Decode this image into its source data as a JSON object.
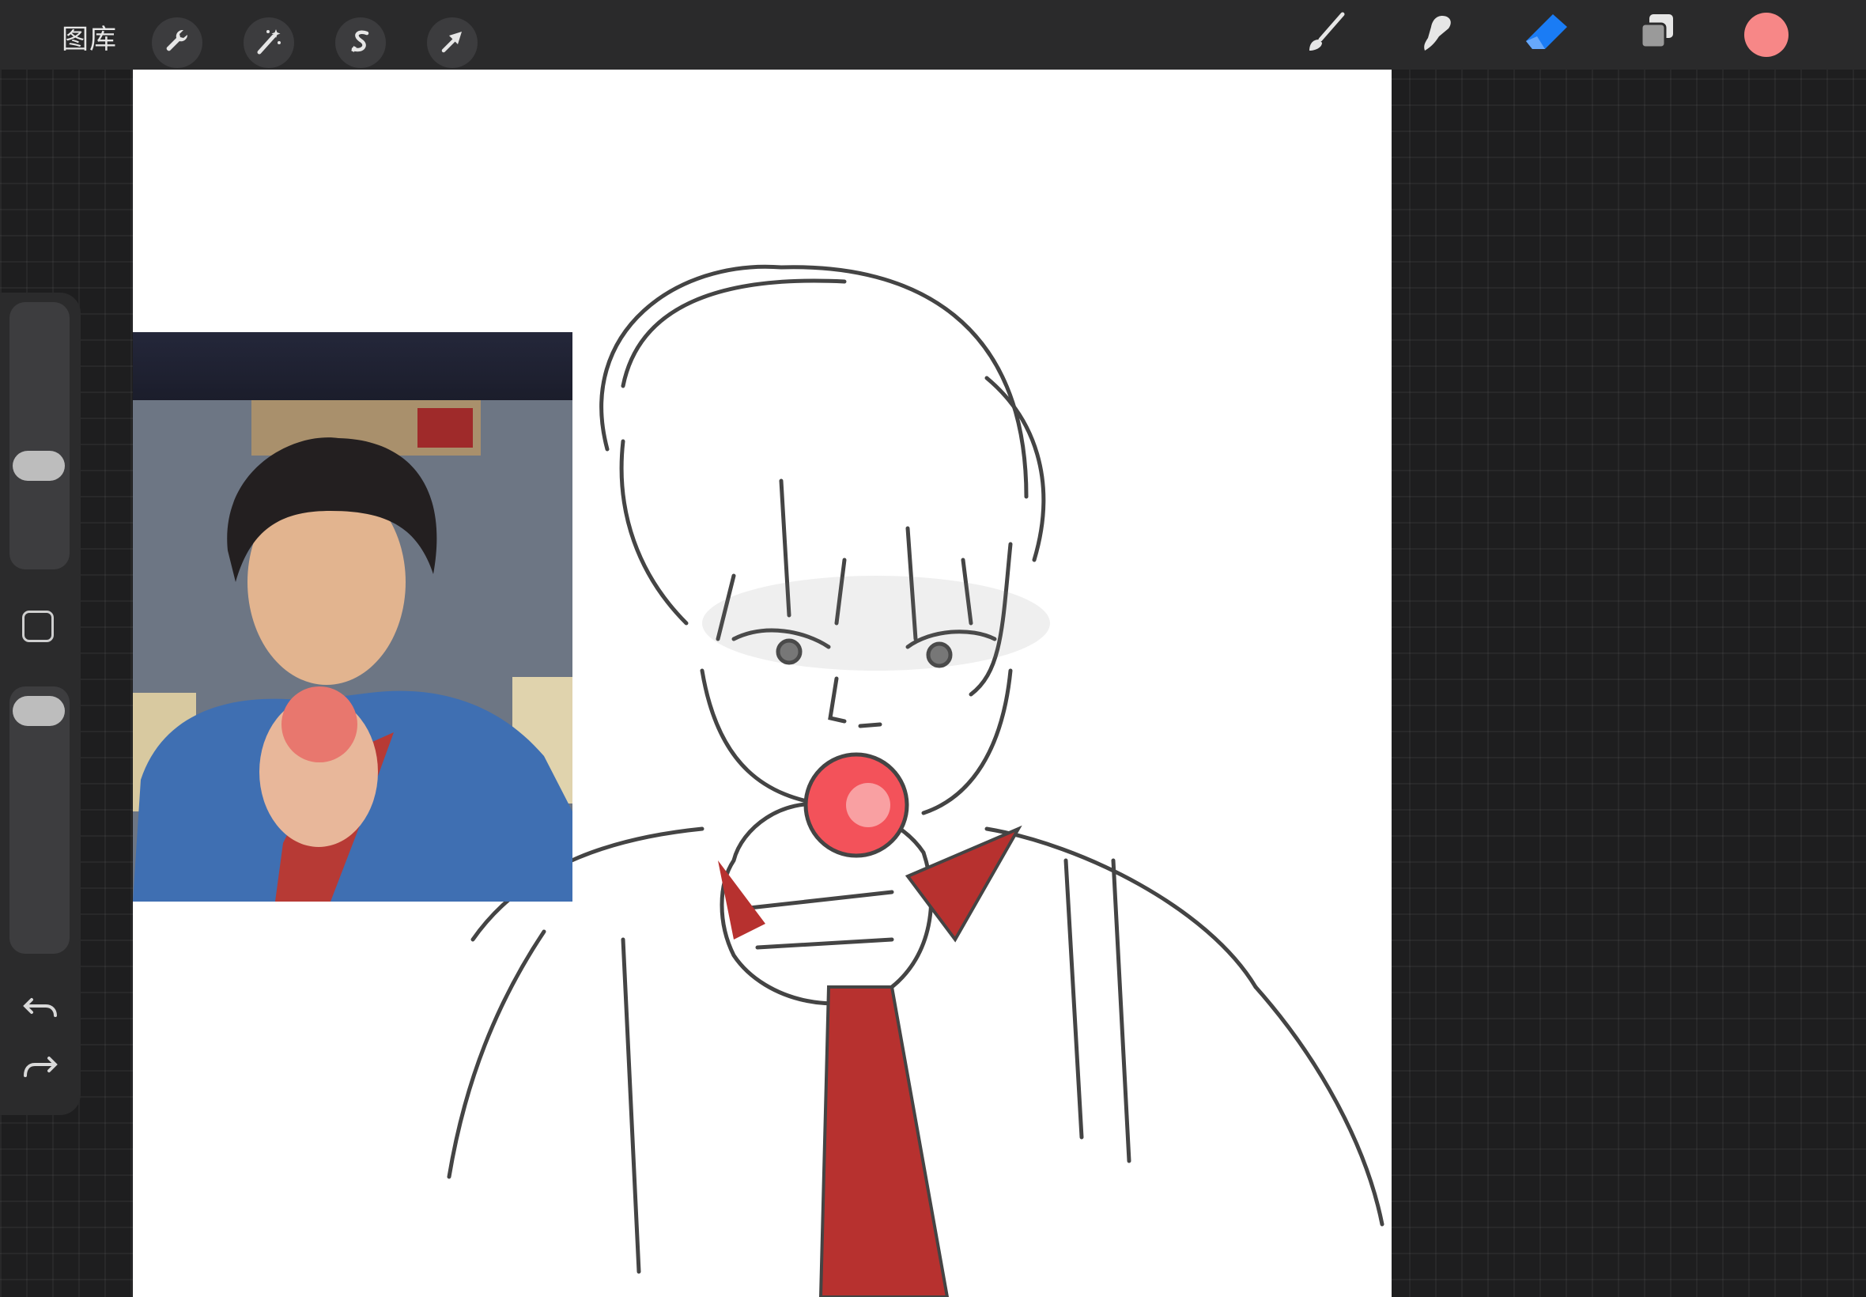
{
  "app": {
    "gallery_label": "图库"
  },
  "toolbar": {
    "left_tools": [
      "wrench-icon",
      "magic-wand-icon",
      "selection-s-icon",
      "transform-arrow-icon"
    ],
    "right_tools": [
      "brush-icon",
      "smudge-icon",
      "eraser-icon",
      "layers-icon"
    ],
    "active_tool": "eraser-icon",
    "accent_color": "#1a7cf5",
    "current_color": "#f78787"
  },
  "sidebar": {
    "brush_size_level": 0.62,
    "opacity_level": 0.96,
    "undo_icon": "undo-arrow-icon",
    "redo_icon": "redo-arrow-icon"
  },
  "canvas": {
    "background": "#ffffff",
    "reference_window": "reference-photo"
  }
}
